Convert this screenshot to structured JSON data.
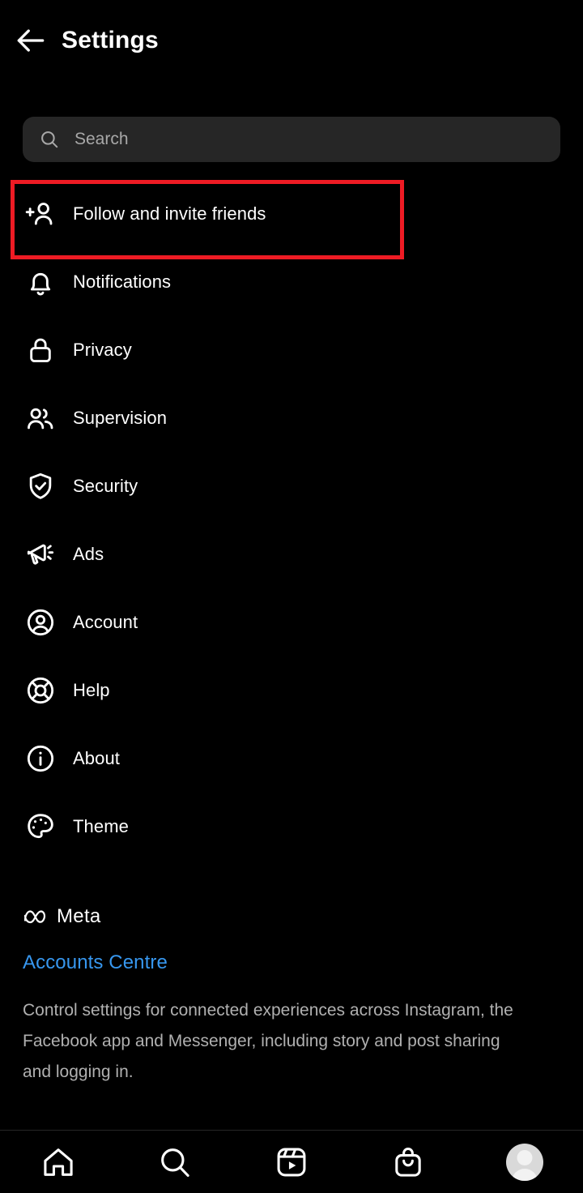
{
  "header": {
    "title": "Settings",
    "back_icon": "arrow-left-icon"
  },
  "search": {
    "placeholder": "Search",
    "value": "",
    "icon": "search-icon"
  },
  "settings_list": [
    {
      "label": "Follow and invite friends",
      "icon": "person-plus-icon",
      "highlighted": true
    },
    {
      "label": "Notifications",
      "icon": "bell-icon",
      "highlighted": false
    },
    {
      "label": "Privacy",
      "icon": "lock-icon",
      "highlighted": false
    },
    {
      "label": "Supervision",
      "icon": "people-icon",
      "highlighted": false
    },
    {
      "label": "Security",
      "icon": "shield-check-icon",
      "highlighted": false
    },
    {
      "label": "Ads",
      "icon": "megaphone-icon",
      "highlighted": false
    },
    {
      "label": "Account",
      "icon": "person-circle-icon",
      "highlighted": false
    },
    {
      "label": "Help",
      "icon": "life-ring-icon",
      "highlighted": false
    },
    {
      "label": "About",
      "icon": "info-circle-icon",
      "highlighted": false
    },
    {
      "label": "Theme",
      "icon": "palette-icon",
      "highlighted": false
    }
  ],
  "meta_section": {
    "brand": "Meta",
    "brand_icon": "meta-infinity-icon",
    "link_label": "Accounts Centre",
    "description": "Control settings for connected experiences across Instagram, the Facebook app and Messenger, including story and post sharing and logging in."
  },
  "bottom_nav": [
    {
      "name": "home",
      "icon": "home-icon"
    },
    {
      "name": "search",
      "icon": "search-icon"
    },
    {
      "name": "reels",
      "icon": "reels-icon"
    },
    {
      "name": "shop",
      "icon": "shop-bag-icon"
    },
    {
      "name": "profile",
      "icon": "avatar-icon"
    }
  ],
  "colors": {
    "background": "#000000",
    "search_field": "#262626",
    "primary_text": "#ffffff",
    "secondary_text": "#b0b0b0",
    "link": "#3797ef",
    "highlight_box": "#ee1b24"
  }
}
